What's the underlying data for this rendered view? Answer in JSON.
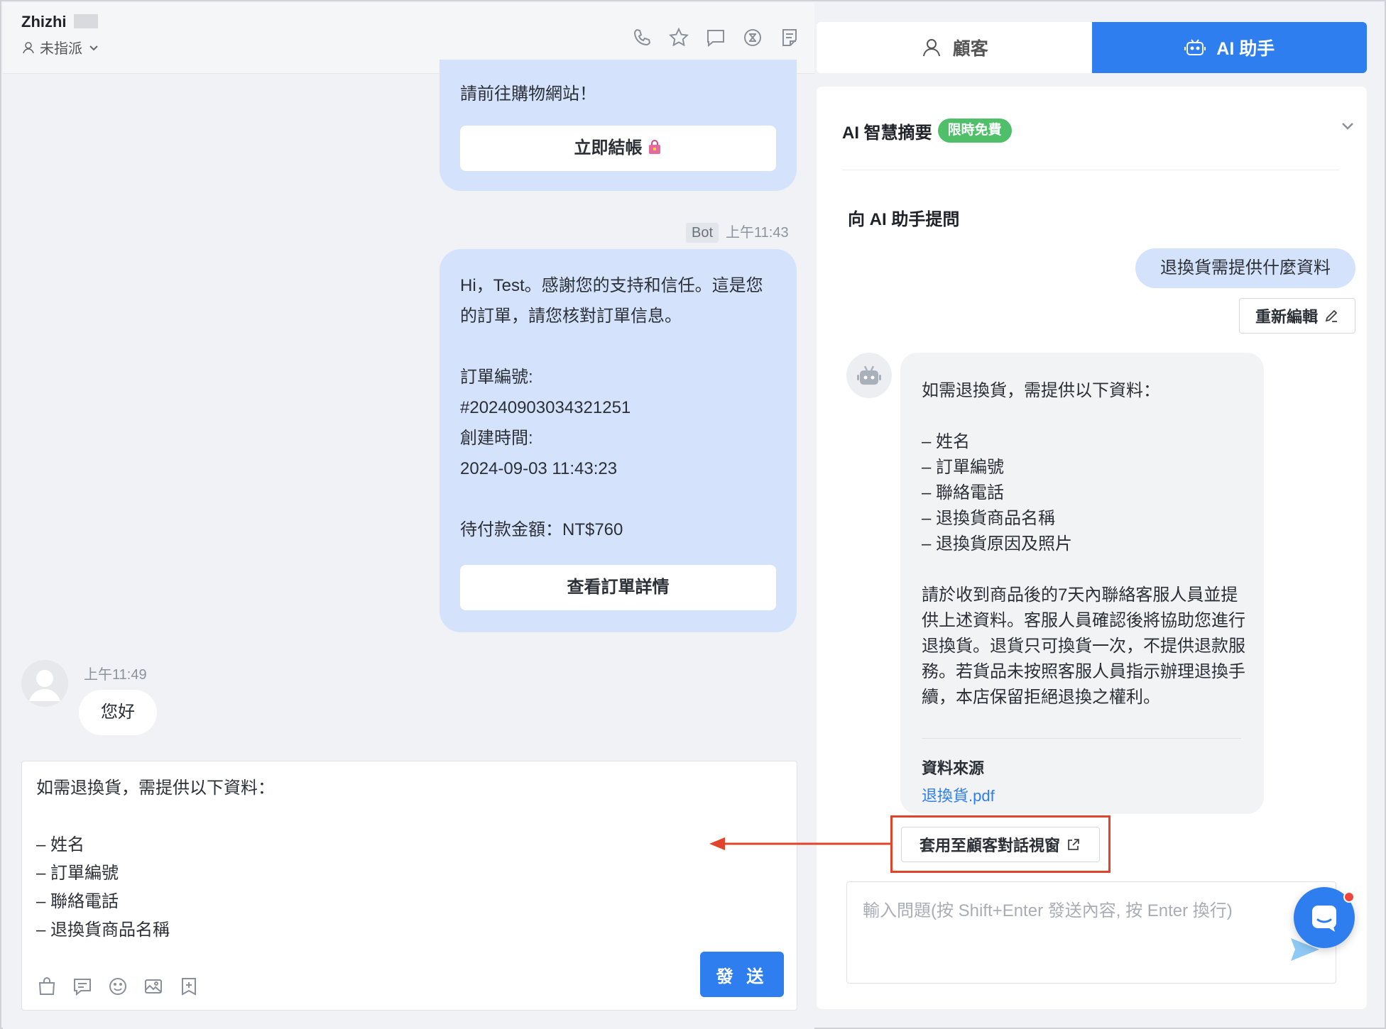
{
  "header": {
    "contact_name": "Zhizhi",
    "assign_label": "未指派",
    "tools": [
      "phone-icon",
      "star-icon",
      "chat-bubble-icon",
      "tag-circle-icon",
      "notes-icon"
    ]
  },
  "messages": {
    "bubble1_text": "請前往購物網站！",
    "checkout_button": "立即結帳",
    "bot_tag": "Bot",
    "bot_time": "上午11:43",
    "order_lines": [
      "Hi，Test。感謝您的支持和信任。這是您的訂單，請您核對訂單信息。",
      "",
      "訂單編號:",
      "#20240903034321251",
      "創建時間:",
      "2024-09-03 11:43:23",
      "",
      "待付款金額：NT$760"
    ],
    "order_button": "查看訂單詳情",
    "user_time": "上午11:49",
    "user_text": "您好"
  },
  "composer": {
    "draft_text": "如需退換貨，需提供以下資料：\n\n– 姓名\n– 訂單編號\n– 聯絡電話\n– 退換貨商品名稱",
    "send_label": "發 送",
    "tools": [
      "bag-icon",
      "quick-reply-icon",
      "emoji-icon",
      "image-icon",
      "bookmark-add-icon"
    ]
  },
  "tabs": {
    "customer_label": "顧客",
    "ai_label": "AI 助手",
    "active": "ai"
  },
  "ai_panel": {
    "summary_title": "AI 智慧摘要",
    "free_badge": "限時免費",
    "ask_title": "向 AI 助手提問",
    "question": "退換貨需提供什麼資料",
    "reedit_label": "重新編輯",
    "answer_lines": [
      "如需退換貨，需提供以下資料：",
      "",
      "– 姓名",
      "– 訂單編號",
      "– 聯絡電話",
      "– 退換貨商品名稱",
      "– 退換貨原因及照片",
      "",
      "請於收到商品後的7天內聯絡客服人員並提供上述資料。客服人員確認後將協助您進行退換貨。退貨只可換貨一次，不提供退款服務。若貨品未按照客服人員指示辦理退換手續，本店保留拒絕退換之權利。"
    ],
    "source_title": "資料來源",
    "source_link": "退換貨.pdf",
    "apply_label": "套用至顧客對話視窗",
    "input_placeholder": "輸入問題(按 Shift+Enter 發送內容, 按 Enter 換行)"
  },
  "colors": {
    "accent": "#2f7ef0",
    "bot_bubble": "#d4e2fc",
    "free_badge": "#4fbf6a",
    "highlight_box": "#e0442a"
  }
}
